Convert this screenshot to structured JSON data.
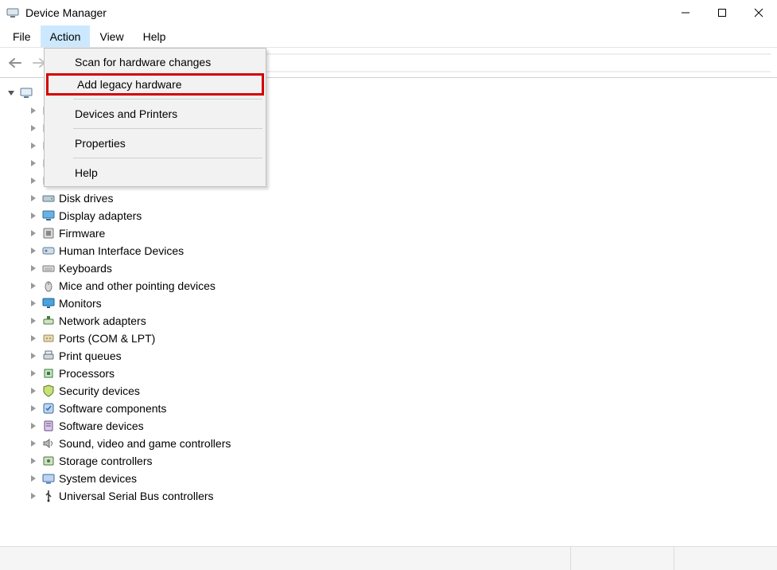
{
  "window": {
    "title": "Device Manager"
  },
  "menubar": {
    "file": "File",
    "action": "Action",
    "view": "View",
    "help": "Help"
  },
  "action_menu": {
    "scan": "Scan for hardware changes",
    "add_legacy": "Add legacy hardware",
    "devices_printers": "Devices and Printers",
    "properties": "Properties",
    "help": "Help"
  },
  "tree": {
    "root_label": "",
    "items": [
      {
        "label": "",
        "icon": "generic"
      },
      {
        "label": "",
        "icon": "generic"
      },
      {
        "label": "",
        "icon": "generic"
      },
      {
        "label": "",
        "icon": "generic"
      },
      {
        "label": "",
        "icon": "generic"
      },
      {
        "label": "Disk drives",
        "icon": "disk"
      },
      {
        "label": "Display adapters",
        "icon": "display"
      },
      {
        "label": "Firmware",
        "icon": "firmware"
      },
      {
        "label": "Human Interface Devices",
        "icon": "hid"
      },
      {
        "label": "Keyboards",
        "icon": "keyboard"
      },
      {
        "label": "Mice and other pointing devices",
        "icon": "mouse"
      },
      {
        "label": "Monitors",
        "icon": "monitor"
      },
      {
        "label": "Network adapters",
        "icon": "network"
      },
      {
        "label": "Ports (COM & LPT)",
        "icon": "ports"
      },
      {
        "label": "Print queues",
        "icon": "printer"
      },
      {
        "label": "Processors",
        "icon": "cpu"
      },
      {
        "label": "Security devices",
        "icon": "security"
      },
      {
        "label": "Software components",
        "icon": "swcomp"
      },
      {
        "label": "Software devices",
        "icon": "swdev"
      },
      {
        "label": "Sound, video and game controllers",
        "icon": "sound"
      },
      {
        "label": "Storage controllers",
        "icon": "storage"
      },
      {
        "label": "System devices",
        "icon": "system"
      },
      {
        "label": "Universal Serial Bus controllers",
        "icon": "usb"
      }
    ]
  }
}
